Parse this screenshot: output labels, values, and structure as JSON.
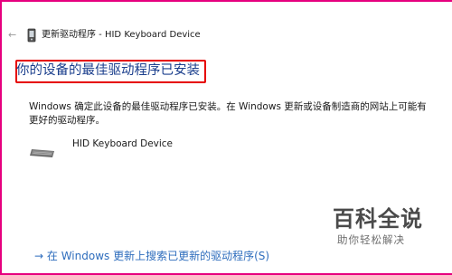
{
  "colors": {
    "background_frame": "#e6007e",
    "heading": "#1a3e8c",
    "highlight_border": "#e60000",
    "link": "#2e6dbd"
  },
  "titlebar": {
    "back_icon": "back-arrow-icon",
    "device_icon": "device-icon",
    "title": "更新驱动程序 - HID Keyboard Device"
  },
  "main": {
    "heading": "你的设备的最佳驱动程序已安装",
    "description": "Windows 确定此设备的最佳驱动程序已安装。在 Windows 更新或设备制造商的网站上可能有更好的驱动程序。",
    "device": {
      "icon": "keyboard-icon",
      "name": "HID Keyboard Device"
    },
    "link": {
      "arrow": "→",
      "text": "在 Windows 更新上搜索已更新的驱动程序(S)"
    }
  },
  "watermark": {
    "title": "百科全说",
    "subtitle": "助你轻松解决"
  }
}
